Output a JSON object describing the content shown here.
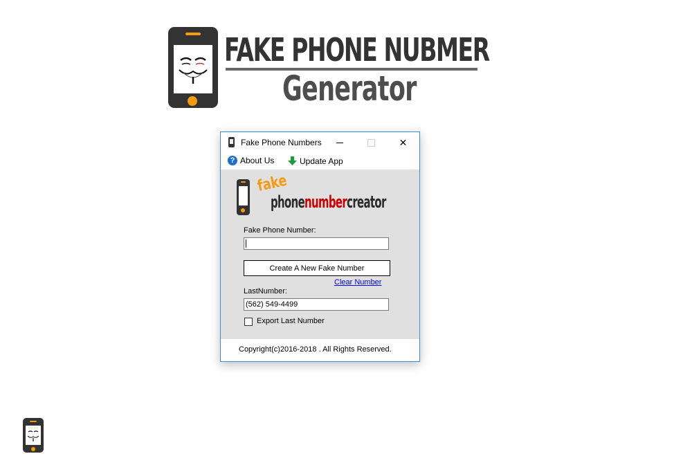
{
  "banner": {
    "title": "FAKE PHONE NUBMER",
    "subtitle": "Generator",
    "icon": "anonymous-mask-phone-icon"
  },
  "window": {
    "title": "Fake Phone Numbers",
    "controls": {
      "minimize": "minimize",
      "maximize": "maximize",
      "close": "✕"
    },
    "menu": [
      {
        "label": "About Us",
        "icon": "help-icon"
      },
      {
        "label": "Update App",
        "icon": "download-arrow-icon"
      }
    ],
    "logo": {
      "prefix": "fake",
      "part1": "phone",
      "part2": "number",
      "part3": "creator"
    },
    "form": {
      "fake_number_label": "Fake Phone Number:",
      "fake_number_value": "",
      "create_button": "Create A New Fake Number",
      "clear_link": "Clear Number",
      "last_number_label": "LastNumber:",
      "last_number_value": "(562) 549-4499",
      "export_label": "Export Last Number",
      "export_checked": false
    },
    "footer": "Copyright(c)2016-2018 . All Rights Reserved."
  },
  "colors": {
    "accent": "#f39c12",
    "dark": "#333333",
    "link": "#0000ee",
    "window_border": "#3c8ddc"
  }
}
